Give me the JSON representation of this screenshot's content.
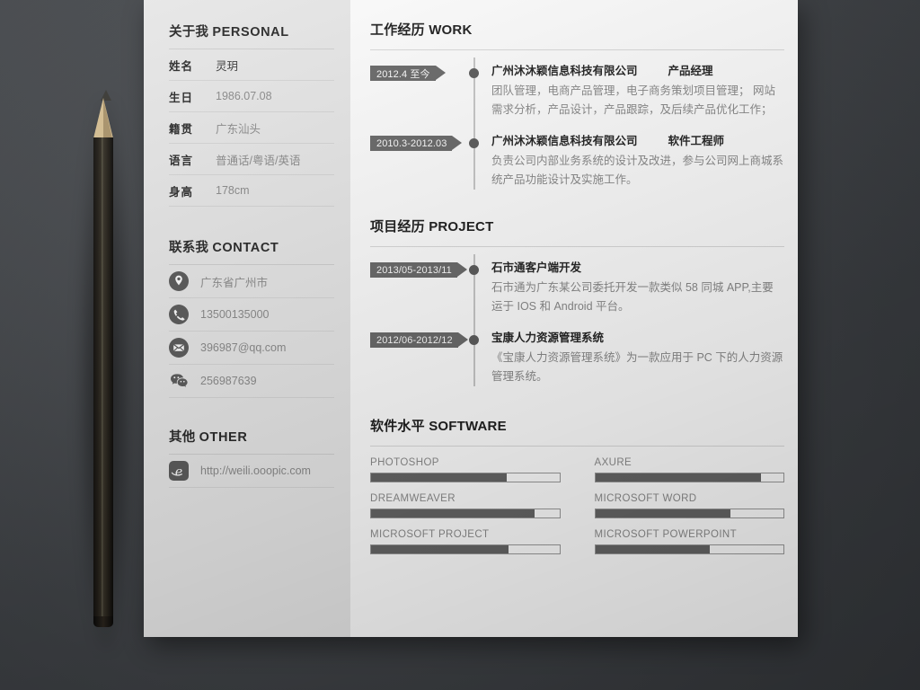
{
  "sidebar": {
    "personal": {
      "title_cn": "关于我",
      "title_en": "PERSONAL",
      "rows": [
        {
          "label": "姓名",
          "value": "灵玥",
          "dark": true
        },
        {
          "label": "生日",
          "value": "1986.07.08",
          "dark": false
        },
        {
          "label": "籍贯",
          "value": "广东汕头",
          "dark": false
        },
        {
          "label": "语言",
          "value": "普通话/粤语/英语",
          "dark": false
        },
        {
          "label": "身高",
          "value": "178cm",
          "dark": false
        }
      ]
    },
    "contact": {
      "title_cn": "联系我",
      "title_en": "CONTACT",
      "rows": [
        {
          "icon": "location-pin-icon",
          "value": "广东省广州市"
        },
        {
          "icon": "phone-icon",
          "value": "13500135000"
        },
        {
          "icon": "envelope-icon",
          "value": "396987@qq.com"
        },
        {
          "icon": "wechat-icon",
          "value": "256987639"
        }
      ]
    },
    "other": {
      "title_cn": "其他",
      "title_en": "OTHER",
      "rows": [
        {
          "icon": "internet-explorer-icon",
          "value": "http://weili.ooopic.com"
        }
      ]
    }
  },
  "main": {
    "work": {
      "title_cn": "工作经历",
      "title_en": "WORK",
      "items": [
        {
          "date": "2012.4 至今",
          "company": "广州沐沐颖信息科技有限公司",
          "role": "产品经理",
          "desc": "团队管理，电商产品管理，电子商务策划项目管理；  网站需求分析，产品设计，产品跟踪，及后续产品优化工作；"
        },
        {
          "date": "2010.3-2012.03",
          "company": "广州沐沐颖信息科技有限公司",
          "role": "软件工程师",
          "desc": "负责公司内部业务系统的设计及改进，参与公司网上商城系统产品功能设计及实施工作。"
        }
      ]
    },
    "project": {
      "title_cn": "项目经历",
      "title_en": "PROJECT",
      "items": [
        {
          "date": "2013/05-2013/11",
          "company": "石市通客户端开发",
          "role": "",
          "desc": "石市通为广东某公司委托开发一款类似 58 同城 APP,主要运于 IOS 和 Android 平台。"
        },
        {
          "date": "2012/06-2012/12",
          "company": "宝康人力资源管理系统",
          "role": "",
          "desc": "《宝康人力资源管理系统》为一款应用于 PC 下的人力资源管理系统。"
        }
      ]
    },
    "software": {
      "title_cn": "软件水平",
      "title_en": "SOFTWARE",
      "items": [
        {
          "name": "PHOTOSHOP",
          "percent": 72
        },
        {
          "name": "AXURE",
          "percent": 88
        },
        {
          "name": "DREAMWEAVER",
          "percent": 87
        },
        {
          "name": "MICROSOFT WORD",
          "percent": 72
        },
        {
          "name": "MICROSOFT PROJECT",
          "percent": 73
        },
        {
          "name": "MICROSOFT POWERPOINT",
          "percent": 61
        }
      ]
    }
  },
  "colors": {
    "paper": "#ffffff",
    "sidebar_bg": "#e9e9e9",
    "accent_dark": "#666666",
    "badge": "#6b6b6b",
    "muted_text": "#8d8d8d",
    "backdrop": "#45484c"
  }
}
